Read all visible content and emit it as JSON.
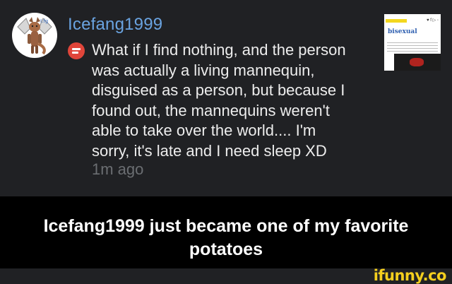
{
  "comment": {
    "username": "Icefang1999",
    "text": "What if I find nothing, and the person\nwas actually a living mannequin,\ndisguised as a person, but because I\nfound out, the mannequins weren't\nable to take over the world.... I'm\nsorry, it's late and I need sleep XD",
    "timestamp": "1m ago",
    "avatar_icon": "winged-fox-character-avatar",
    "comment_icon": "comment-bubble-icon",
    "comment_icon_color": "#e0453a",
    "username_color": "#6aa3e0"
  },
  "thumbnail": {
    "word": "bisexual",
    "badge_icon": "top-definition-badge",
    "badge_color": "#f3d71f"
  },
  "caption": {
    "text": "Icefang1999 just became one of my favorite potatoes"
  },
  "watermark": {
    "text": "ifunny.co",
    "color": "#f4cf1e"
  }
}
